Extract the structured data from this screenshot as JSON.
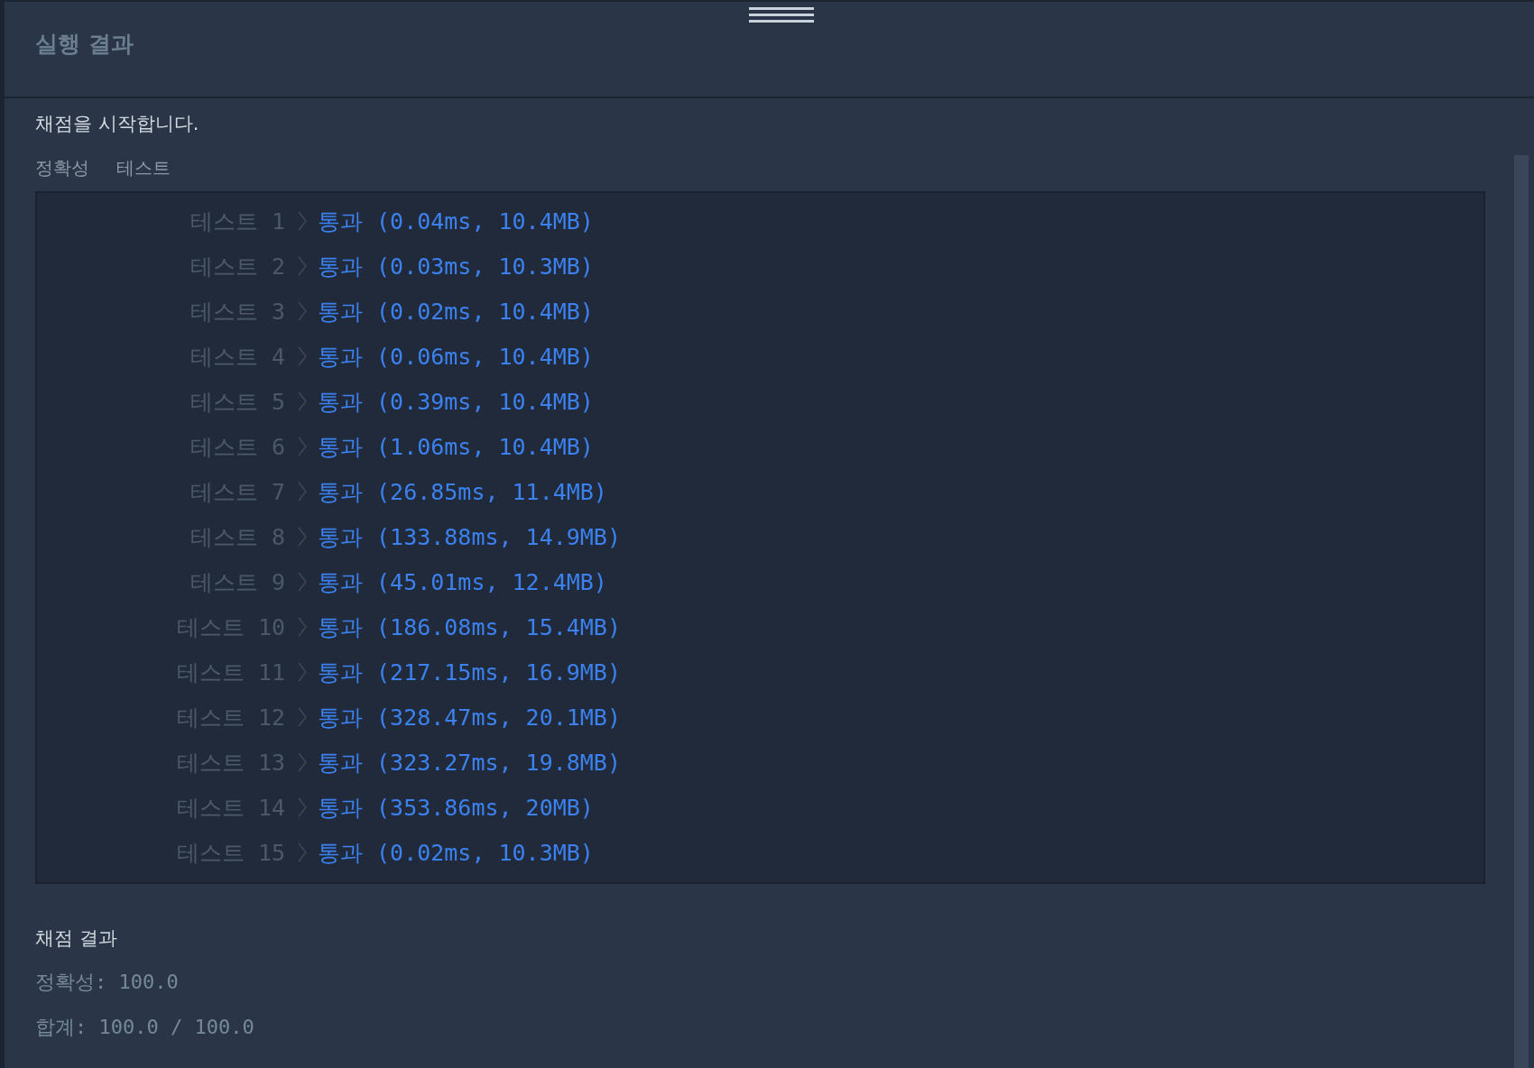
{
  "panel": {
    "title": "실행 결과"
  },
  "status_message": "채점을 시작합니다.",
  "section_label": {
    "group": "정확성",
    "name": "테스트"
  },
  "tests": [
    {
      "label": "테스트 1",
      "result": "통과 (0.04ms, 10.4MB)"
    },
    {
      "label": "테스트 2",
      "result": "통과 (0.03ms, 10.3MB)"
    },
    {
      "label": "테스트 3",
      "result": "통과 (0.02ms, 10.4MB)"
    },
    {
      "label": "테스트 4",
      "result": "통과 (0.06ms, 10.4MB)"
    },
    {
      "label": "테스트 5",
      "result": "통과 (0.39ms, 10.4MB)"
    },
    {
      "label": "테스트 6",
      "result": "통과 (1.06ms, 10.4MB)"
    },
    {
      "label": "테스트 7",
      "result": "통과 (26.85ms, 11.4MB)"
    },
    {
      "label": "테스트 8",
      "result": "통과 (133.88ms, 14.9MB)"
    },
    {
      "label": "테스트 9",
      "result": "통과 (45.01ms, 12.4MB)"
    },
    {
      "label": "테스트 10",
      "result": "통과 (186.08ms, 15.4MB)"
    },
    {
      "label": "테스트 11",
      "result": "통과 (217.15ms, 16.9MB)"
    },
    {
      "label": "테스트 12",
      "result": "통과 (328.47ms, 20.1MB)"
    },
    {
      "label": "테스트 13",
      "result": "통과 (323.27ms, 19.8MB)"
    },
    {
      "label": "테스트 14",
      "result": "통과 (353.86ms, 20MB)"
    },
    {
      "label": "테스트 15",
      "result": "통과 (0.02ms, 10.3MB)"
    }
  ],
  "summary": {
    "title": "채점 결과",
    "lines": [
      "정확성: 100.0",
      "합계: 100.0 / 100.0"
    ]
  }
}
